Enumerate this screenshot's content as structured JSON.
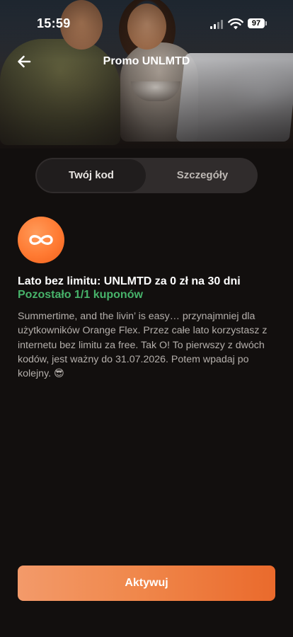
{
  "status_bar": {
    "time": "15:59",
    "battery": "97"
  },
  "header": {
    "title": "Promo UNLMTD",
    "back_icon": "arrow-left-icon"
  },
  "tabs": [
    {
      "label": "Twój kod",
      "active": true
    },
    {
      "label": "Szczegóły",
      "active": false
    }
  ],
  "offer": {
    "icon": "infinity-icon",
    "title": "Lato bez limitu: UNLMTD za 0 zł na 30 dni",
    "remaining": "Pozostało 1/1 kuponów",
    "description": "Summertime, and the livin’ is easy… przynajmniej dla użytkowników Orange Flex. Przez całe lato korzystasz z internetu bez limitu za free. Tak O! To pierwszy z dwóch kodów, jest ważny do 31.07.2026. Potem wpadaj po kolejny. 😎"
  },
  "cta": {
    "label": "Aktywuj"
  },
  "colors": {
    "accent": "#f0884c",
    "remaining_green": "#47b36a",
    "background": "#120f0e"
  }
}
